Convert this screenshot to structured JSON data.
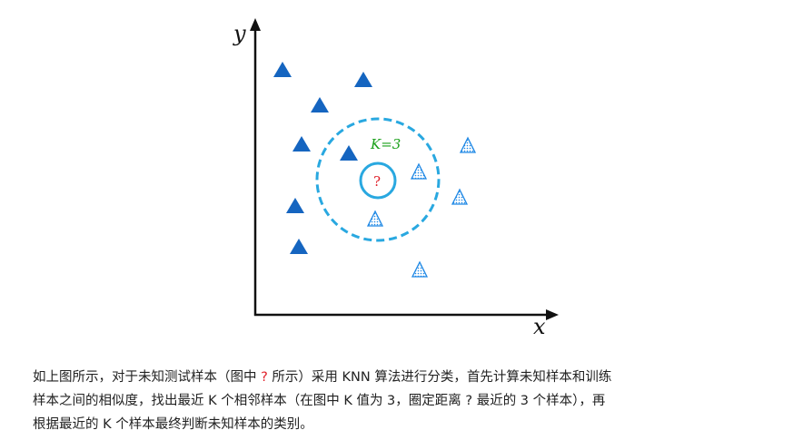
{
  "diagram": {
    "y_axis_label": "y",
    "x_axis_label": "x",
    "k_label": "K=3",
    "unknown_symbol": "?",
    "colors": {
      "class_a": "#1565c0",
      "class_b": "#1e88e5",
      "circle": "#29a8e0",
      "k_label": "#1aa01a",
      "unknown": "#e0202a"
    }
  },
  "caption": {
    "line1_a": "如上图所示，对于未知测试样本（图中 ",
    "q1": "?",
    "line1_b": " 所示）采用 KNN 算法进行分类，首先计算未知样本和训练",
    "line2": "样本之间的相似度，找出最近 K 个相邻样本（在图中 K 值为 3，圈定距离 ? 最近的 3 个样本），再",
    "line3": "根据最近的 K 个样本最终判断未知样本的类别。"
  }
}
